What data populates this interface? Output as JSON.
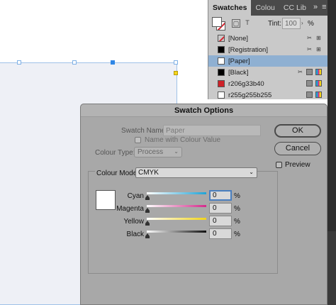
{
  "panel": {
    "tabs": [
      {
        "label": "Swatches",
        "active": true
      },
      {
        "label": "Colou",
        "active": false
      },
      {
        "label": "CC Lib",
        "active": false
      }
    ],
    "more_label": "»",
    "menu_label": "≡",
    "tint_label": "Tint:",
    "tint_value": "100",
    "tint_unit": "%",
    "swatches": [
      {
        "name": "[None]",
        "color": "none",
        "icons": [
          "no-edit-icon",
          "registration-icon"
        ]
      },
      {
        "name": "[Registration]",
        "color": "#000000",
        "icons": [
          "no-edit-icon",
          "registration-icon"
        ]
      },
      {
        "name": "[Paper]",
        "color": "#ffffff",
        "selected": true,
        "icons": []
      },
      {
        "name": "[Black]",
        "color": "#000000",
        "icons": [
          "no-edit-icon",
          "process-icon",
          "cmyk-icon"
        ]
      },
      {
        "name": "r206g33b40",
        "color": "#ce2128",
        "icons": [
          "process-icon",
          "cmyk-icon"
        ]
      },
      {
        "name": "r255g255b255",
        "color": "#ffffff",
        "icons": [
          "process-icon",
          "cmyk-icon"
        ]
      }
    ]
  },
  "dialog": {
    "title": "Swatch Options",
    "swatch_name_label": "Swatch Name:",
    "swatch_name_value": "Paper",
    "name_with_value_label": "Name with Colour Value",
    "colour_type_label": "Colour Type:",
    "colour_type_value": "Process",
    "colour_mode_label": "Colour Mode:",
    "colour_mode_value": "CMYK",
    "ok_label": "OK",
    "cancel_label": "Cancel",
    "preview_label": "Preview",
    "pct_symbol": "%",
    "inks": [
      {
        "name": "Cyan",
        "value": "0",
        "gradient_end": "#1fa3d6",
        "focused": true
      },
      {
        "name": "Magenta",
        "value": "0",
        "gradient_end": "#d42a8b"
      },
      {
        "name": "Yellow",
        "value": "0",
        "gradient_end": "#f2d51a"
      },
      {
        "name": "Black",
        "value": "0",
        "gradient_end": "#111111"
      }
    ],
    "preview_color": "#ffffff"
  }
}
